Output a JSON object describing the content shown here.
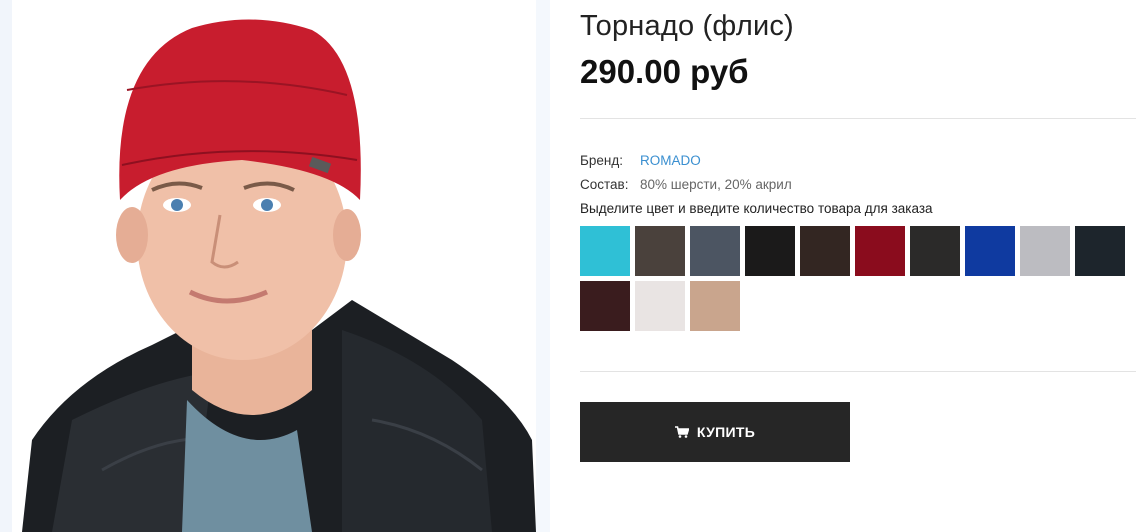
{
  "product": {
    "title": "Торнадо (флис)",
    "price": "290.00 руб",
    "image_icon": "product-photo-hat-model"
  },
  "attributes": {
    "brand_label": "Бренд:",
    "brand_value": "ROMADO",
    "composition_label": "Состав:",
    "composition_value": "80% шерсти, 20% акрил"
  },
  "color_selection": {
    "instruction": "Выделите цвет и введите количество товара для заказа",
    "swatches": [
      {
        "color": "#2fc0d6"
      },
      {
        "color": "#4a413c"
      },
      {
        "color": "#4c5562"
      },
      {
        "color": "#1b1a1a"
      },
      {
        "color": "#332622"
      },
      {
        "color": "#8a0c1d"
      },
      {
        "color": "#2b2a29"
      },
      {
        "color": "#0f3aa0"
      },
      {
        "color": "#bcbcc1"
      },
      {
        "color": "#1d252c"
      },
      {
        "color": "#3a1c1e"
      },
      {
        "color": "#e9e4e3"
      },
      {
        "color": "#c9a58d"
      }
    ]
  },
  "actions": {
    "buy_label": "КУПИТЬ",
    "buy_icon": "cart-icon"
  }
}
